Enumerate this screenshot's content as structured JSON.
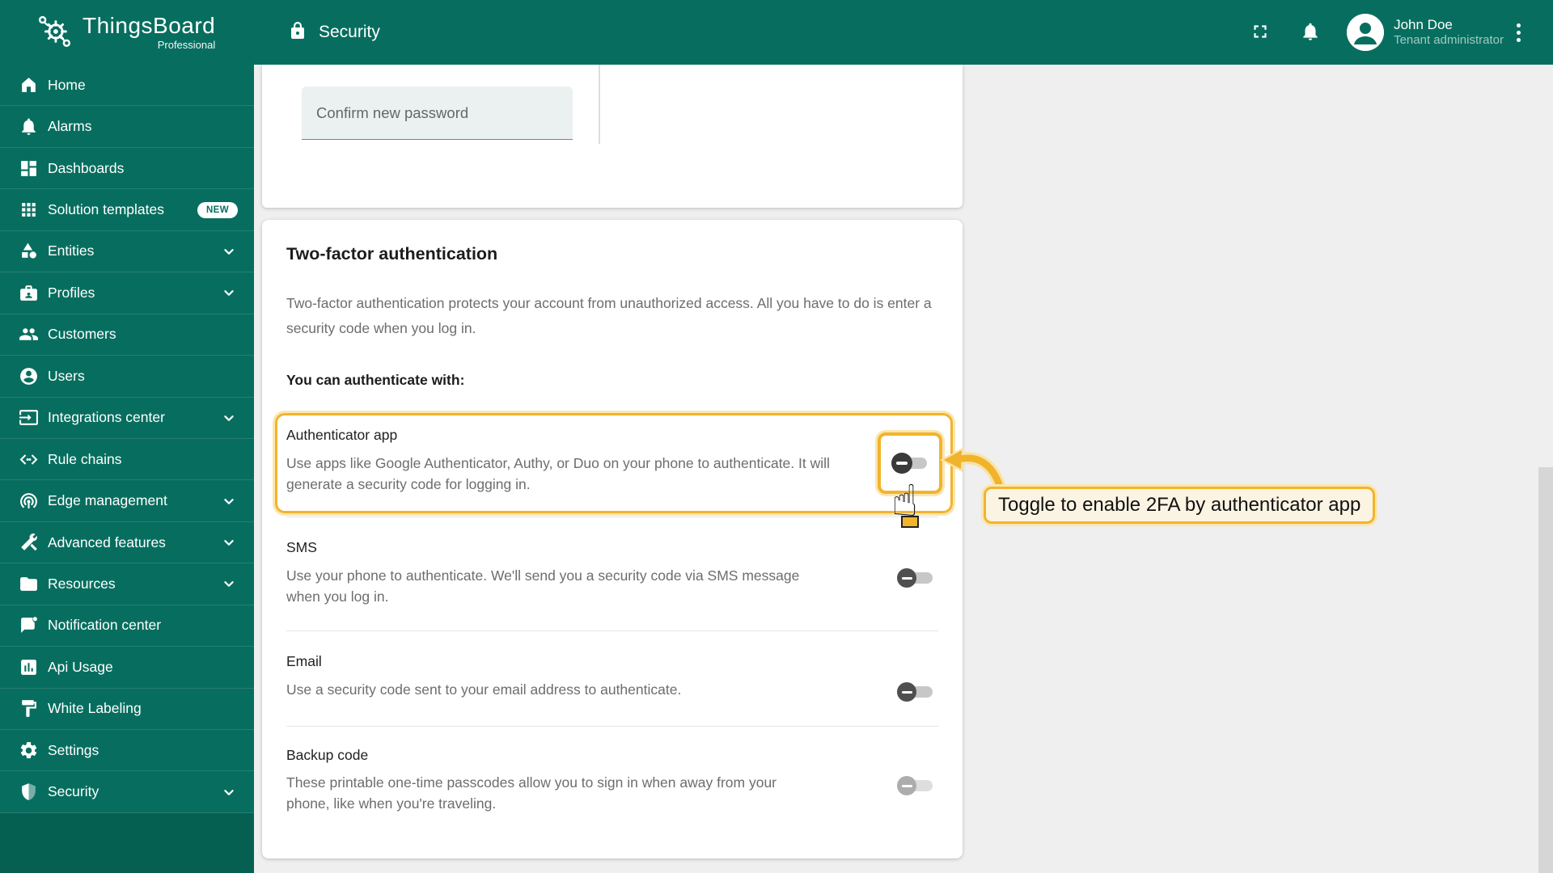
{
  "app": {
    "name": "ThingsBoard",
    "edition": "Professional"
  },
  "header": {
    "title": "Security",
    "user": {
      "name": "John Doe",
      "role": "Tenant administrator"
    }
  },
  "sidebar": {
    "items": [
      {
        "label": "Home",
        "icon": "home-icon",
        "chevron": false
      },
      {
        "label": "Alarms",
        "icon": "bell-icon",
        "chevron": false
      },
      {
        "label": "Dashboards",
        "icon": "dashboards-icon",
        "chevron": false
      },
      {
        "label": "Solution templates",
        "icon": "apps-grid-icon",
        "chevron": false,
        "badge": "NEW"
      },
      {
        "label": "Entities",
        "icon": "entities-icon",
        "chevron": true
      },
      {
        "label": "Profiles",
        "icon": "profiles-badge-icon",
        "chevron": true
      },
      {
        "label": "Customers",
        "icon": "customers-icon",
        "chevron": false
      },
      {
        "label": "Users",
        "icon": "user-circle-icon",
        "chevron": false
      },
      {
        "label": "Integrations center",
        "icon": "integrations-icon",
        "chevron": true
      },
      {
        "label": "Rule chains",
        "icon": "rule-chains-icon",
        "chevron": false
      },
      {
        "label": "Edge management",
        "icon": "edge-antenna-icon",
        "chevron": true
      },
      {
        "label": "Advanced features",
        "icon": "tools-icon",
        "chevron": true
      },
      {
        "label": "Resources",
        "icon": "folder-icon",
        "chevron": true
      },
      {
        "label": "Notification center",
        "icon": "notification-icon",
        "chevron": false
      },
      {
        "label": "Api Usage",
        "icon": "bar-chart-icon",
        "chevron": false
      },
      {
        "label": "White Labeling",
        "icon": "paint-roller-icon",
        "chevron": false
      },
      {
        "label": "Settings",
        "icon": "gear-icon",
        "chevron": false
      },
      {
        "label": "Security",
        "icon": "shield-icon",
        "chevron": true
      }
    ]
  },
  "password_card": {
    "confirm_placeholder": "Confirm new password"
  },
  "twofa": {
    "title": "Two-factor authentication",
    "description": "Two-factor authentication protects your account from unauthorized access. All you have to do is enter a security code when you log in.",
    "subtitle": "You can authenticate with:",
    "methods": [
      {
        "name": "Authenticator app",
        "description": "Use apps like Google Authenticator, Authy, or Duo on your phone to authenticate. It will generate a security code for logging in.",
        "enabled": false,
        "highlighted": true,
        "disabled": false
      },
      {
        "name": "SMS",
        "description": "Use your phone to authenticate. We'll send you a security code via SMS message when you log in.",
        "enabled": false,
        "highlighted": false,
        "disabled": false
      },
      {
        "name": "Email",
        "description": "Use a security code sent to your email address to authenticate.",
        "enabled": false,
        "highlighted": false,
        "disabled": false
      },
      {
        "name": "Backup code",
        "description": "These printable one-time passcodes allow you to sign in when away from your phone, like when you're traveling.",
        "enabled": false,
        "highlighted": false,
        "disabled": true
      }
    ]
  },
  "annotation": {
    "text": "Toggle to enable 2FA by authenticator app"
  },
  "colors": {
    "primary": "#076E5F",
    "sidebar_lower": "#066052",
    "highlight_yellow": "#F2B42C",
    "highlight_glow": "#FAE6AF",
    "callout_bg": "#FBF4E3",
    "content_bg": "#EFEFEF"
  }
}
